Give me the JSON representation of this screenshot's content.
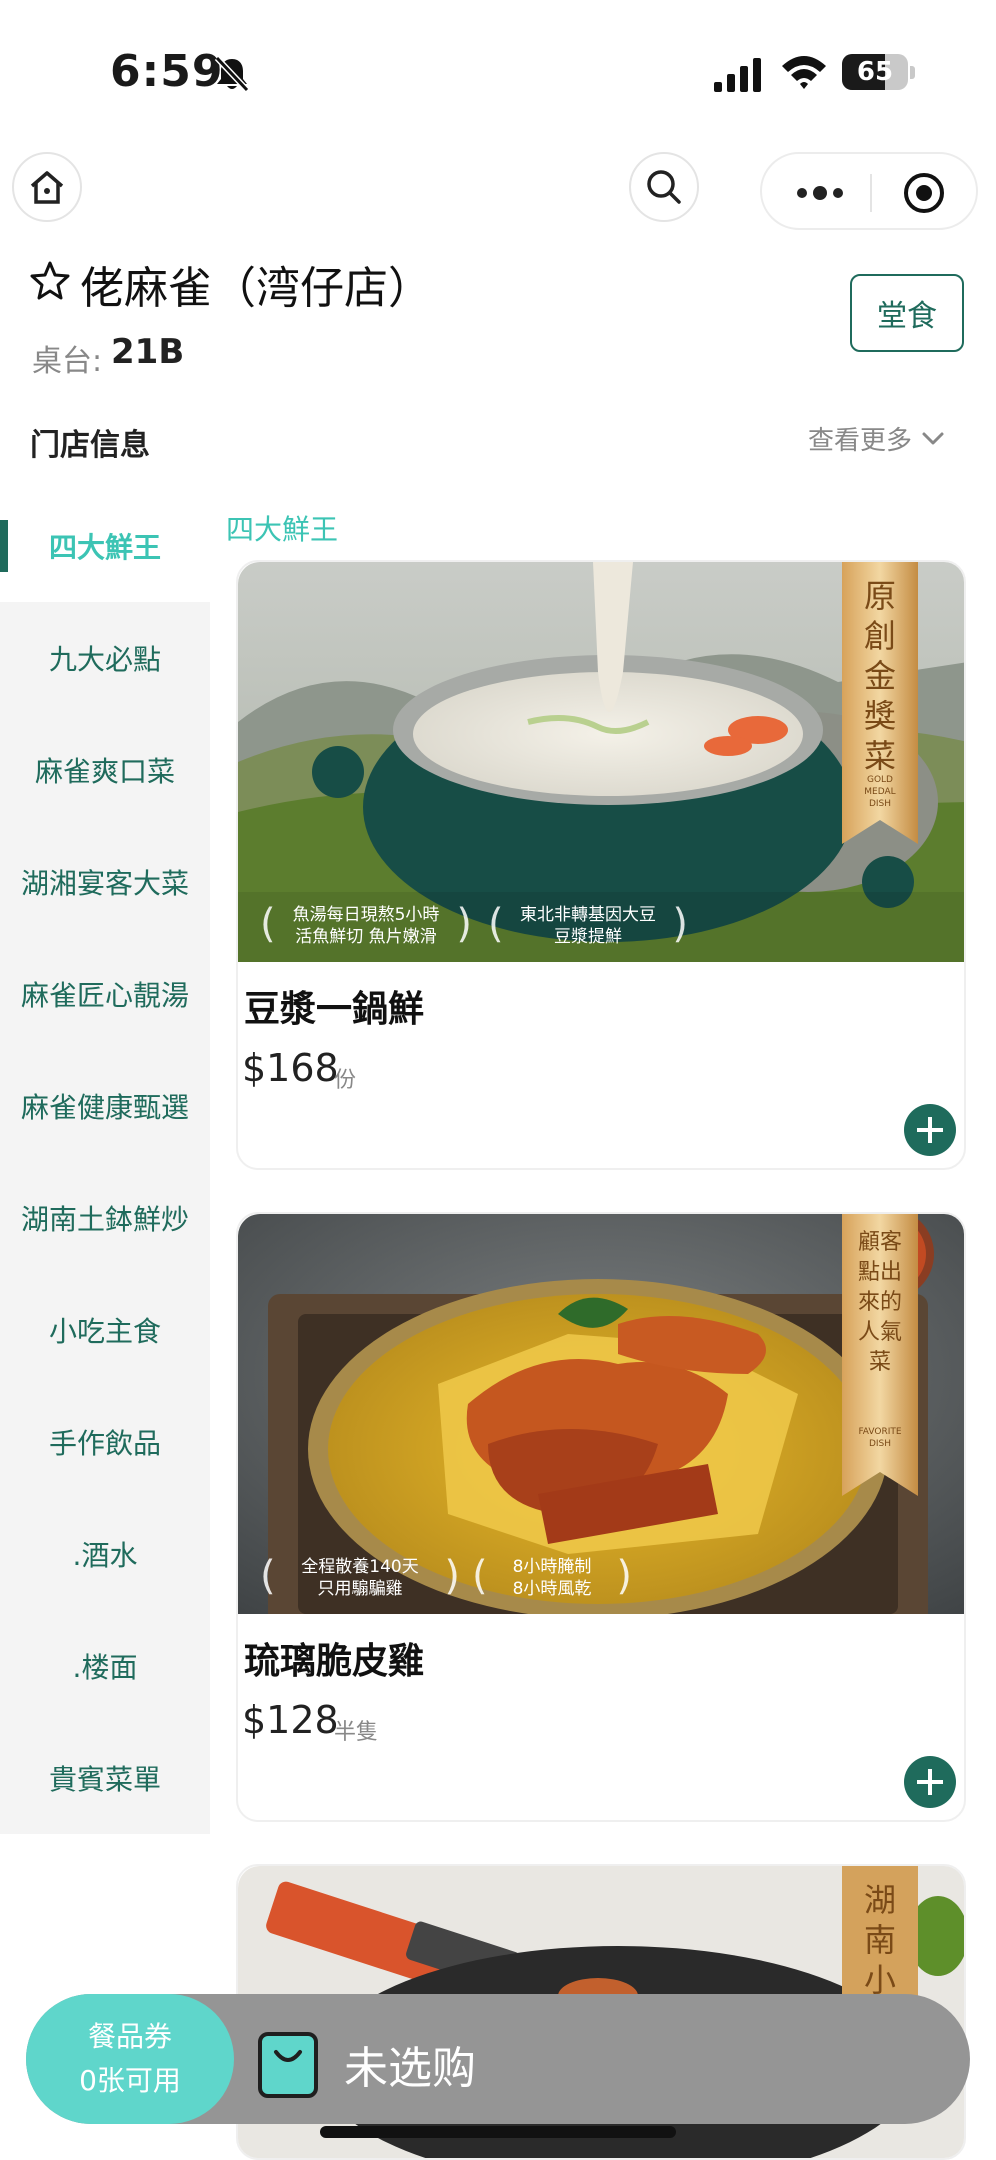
{
  "status_bar": {
    "time": "6:59",
    "battery": "65",
    "battery_level": 0.65
  },
  "store": {
    "name": "佬麻雀（湾仔店）",
    "table_label": "桌台:",
    "table_number": "21B",
    "dine_mode": "堂食"
  },
  "store_info": {
    "title": "门店信息",
    "see_more": "查看更多"
  },
  "sidebar": {
    "items": [
      {
        "label": "四大鮮王",
        "active": true
      },
      {
        "label": "九大必點"
      },
      {
        "label": "麻雀爽口菜"
      },
      {
        "label": "湖湘宴客大菜"
      },
      {
        "label": "麻雀匠心靚湯"
      },
      {
        "label": "麻雀健康甄選"
      },
      {
        "label": "湖南土鉢鮮炒"
      },
      {
        "label": "小吃主食"
      },
      {
        "label": "手作飲品"
      },
      {
        "label": ".酒水"
      },
      {
        "label": ".楼面"
      },
      {
        "label": "貴賓菜單"
      }
    ]
  },
  "section_title": "四大鮮王",
  "dishes": [
    {
      "name": "豆漿一鍋鮮",
      "price": "$168",
      "unit": "份",
      "badge": "原創金獎菜",
      "badge_sub": "GOLD MEDAL DISH",
      "tags": [
        "魚湯每日現熬5小時\n活魚鮮切 魚片嫩滑",
        "東北非轉基因大豆\n豆漿提鮮"
      ]
    },
    {
      "name": "琉璃脆皮雞",
      "price": "$128",
      "unit": "半隻",
      "badge": "顧客點出來的人氣菜",
      "badge_sub": "FAVORITE DISH",
      "tags": [
        "全程散養140天\n只用騸騙雞",
        "8小時腌制\n8小時風乾"
      ]
    },
    {
      "badge": "湖南小炒"
    }
  ],
  "cart": {
    "coupon_title": "餐品券",
    "coupon_count": "0张可用",
    "status": "未选购"
  },
  "colors": {
    "accent": "#1f6b5c",
    "accent_light": "#3cc4b4",
    "coupon_bg": "#5fd6cb",
    "bar_bg": "#959595"
  }
}
